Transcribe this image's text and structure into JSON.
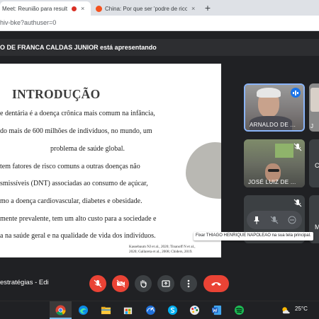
{
  "browser": {
    "tabs": [
      {
        "label": "Meet: Reunião para resultad",
        "recording": true,
        "favicon_color": "#00897b"
      },
      {
        "label": "China: Por que ser 'podre de rico",
        "favicon_color": "#f4511e"
      }
    ],
    "new_tab_label": "+",
    "close_label": "×",
    "url": "hiv-bke?authuser=0"
  },
  "presenting": {
    "text": "O DE FRANCA CALDAS JUNIOR está apresentando"
  },
  "slide": {
    "title": "INTRODUÇÃO",
    "lines": [
      "e dentária é a doença crônica mais comum na infância,",
      "do mais de 600 milhões de indivíduos, no mundo, um",
      "problema de saúde global.",
      "tem fatores de risco comuns a outras doenças não",
      "smissíveis (DNT) associadas ao consumo de açúcar,",
      "mo a doença cardiovascular, diabetes e obesidade.",
      "mente prevalente, tem um alto custo para a sociedade e",
      "a na saúde geral e na qualidade de vida dos indivíduos."
    ],
    "citation_lines": [
      "Kassebaum NJ et al., 2020; Tinanoff N et al.,",
      "2020; Gallaretа et al., 2008; Chiders, 2019."
    ]
  },
  "participants": [
    {
      "name": "ARNALDO DE ...",
      "speaking": true
    },
    {
      "name": "JOSÉ LUIZ DE ...",
      "muted": true
    },
    {
      "name": "J"
    },
    {
      "name": "C"
    },
    {
      "name": "M"
    }
  ],
  "tooltip": "Fixar THIAGO HENRIQUE NAPOLEAO na sua tela principal.",
  "call": {
    "meeting_title": "estratégias - Edi"
  },
  "taskbar": {
    "temperature": "25°C"
  },
  "colors": {
    "accent_blue": "#1a73e8",
    "danger_red": "#ea4335",
    "meet_bg": "#202124"
  }
}
